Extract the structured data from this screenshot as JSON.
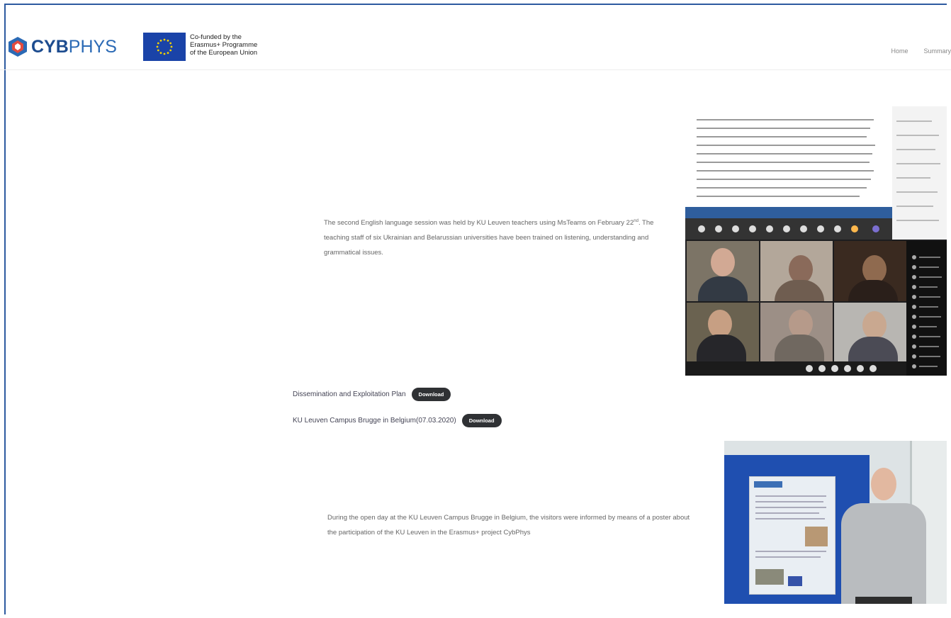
{
  "header": {
    "logo_text_strong": "CYB",
    "logo_text_light": "PHYS",
    "eu_text_line1": "Co-funded by the",
    "eu_text_line2": "Erasmus+ Programme",
    "eu_text_line3": "of the European Union",
    "nav": [
      "Home",
      "Summary"
    ]
  },
  "session": {
    "text_part1": "The second English language session was held by KU Leuven teachers using MsTeams on February 22",
    "text_sup": "nd",
    "text_part2": ". The teaching staff of six Ukrainian and Belarussian universities have been trained on listening, understanding and grammatical issues."
  },
  "downloads": [
    {
      "label": "Dissemination and Exploitation Plan",
      "button": "Download"
    },
    {
      "label": "KU Leuven Campus Brugge in Belgium(07.03.2020)",
      "button": "Download"
    }
  ],
  "openday": {
    "text": "During the open day at the KU Leuven Campus Brugge in Belgium, the visitors were informed by means of a poster about the participation of the KU Leuven in the Erasmus+ project CybPhys"
  },
  "colors": {
    "accent": "#2d5aa0",
    "button": "#2f3134",
    "eu_blue": "#1a43a8"
  }
}
